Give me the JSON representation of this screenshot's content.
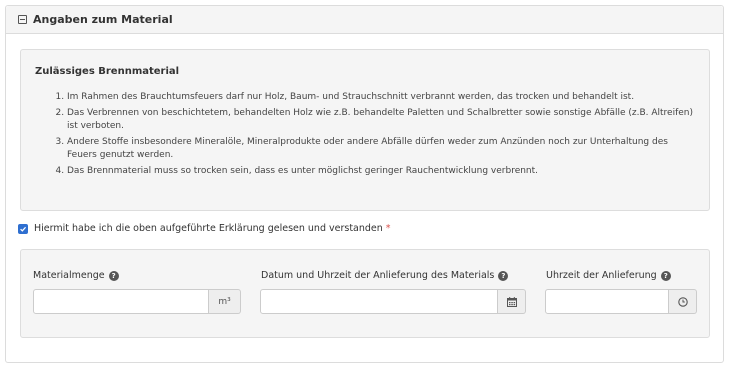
{
  "panel": {
    "title": "Angaben zum Material"
  },
  "info": {
    "title": "Zulässiges Brennmaterial",
    "rules": [
      "Im Rahmen des Brauchtumsfeuers darf nur Holz, Baum- und Strauchschnitt verbrannt werden, das trocken und behandelt ist.",
      "Das Verbrennen von beschichtetem, behandelten Holz wie z.B. behandelte Paletten und Schalbretter sowie sonstige Abfälle (z.B. Altreifen) ist verboten.",
      "Andere Stoffe insbesondere Mineralöle, Mineralprodukte oder andere Abfälle dürfen weder zum Anzünden noch zur Unterhaltung des Feuers genutzt werden.",
      "Das Brennmaterial muss so trocken sein, dass es unter möglichst geringer Rauchentwicklung verbrennt."
    ]
  },
  "consent": {
    "label": "Hiermit habe ich die oben aufgeführte Erklärung gelesen und verstanden",
    "required_marker": "*",
    "checked": true
  },
  "fields": {
    "materialmenge": {
      "label": "Materialmenge",
      "value": "",
      "unit": "m³",
      "help_icon": "question-circle-icon"
    },
    "datum": {
      "label": "Datum und Uhrzeit der Anlieferung des Materials",
      "value": "",
      "addon_icon": "calendar-icon",
      "help_icon": "question-circle-icon"
    },
    "uhrzeit": {
      "label": "Uhrzeit der Anlieferung",
      "value": "",
      "addon_icon": "clock-icon",
      "help_icon": "question-circle-icon"
    }
  },
  "colors": {
    "accent": "#2f6fd0",
    "required": "#d9534f",
    "panel_bg": "#f5f5f5",
    "border": "#dddddd"
  }
}
